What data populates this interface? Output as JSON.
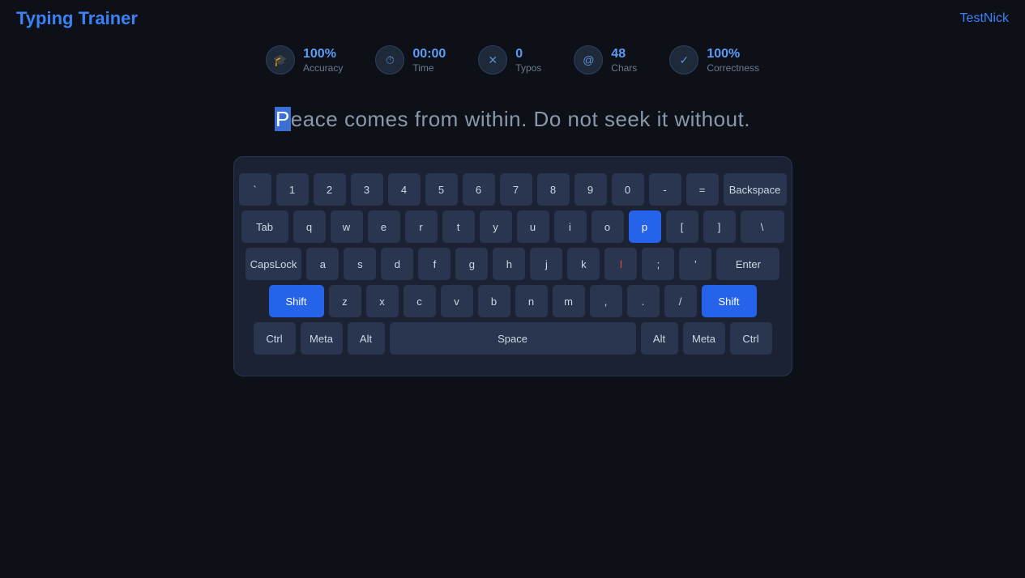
{
  "app": {
    "title": "Typing Trainer",
    "username": "TestNick"
  },
  "stats": [
    {
      "id": "accuracy",
      "icon": "graduation",
      "value": "100%",
      "label": "Accuracy"
    },
    {
      "id": "time",
      "icon": "clock",
      "value": "00:00",
      "label": "Time"
    },
    {
      "id": "typos",
      "icon": "x",
      "value": "0",
      "label": "Typos"
    },
    {
      "id": "chars",
      "icon": "at",
      "value": "48",
      "label": "Chars"
    },
    {
      "id": "correctness",
      "icon": "check",
      "value": "100%",
      "label": "Correctness"
    }
  ],
  "typing": {
    "text": "Peace comes from within. Do not seek it without.",
    "cursor_index": 0
  },
  "keyboard": {
    "rows": [
      {
        "keys": [
          {
            "label": "`",
            "type": "normal"
          },
          {
            "label": "1",
            "type": "normal"
          },
          {
            "label": "2",
            "type": "normal"
          },
          {
            "label": "3",
            "type": "normal"
          },
          {
            "label": "4",
            "type": "normal"
          },
          {
            "label": "5",
            "type": "normal"
          },
          {
            "label": "6",
            "type": "normal"
          },
          {
            "label": "7",
            "type": "normal"
          },
          {
            "label": "8",
            "type": "normal"
          },
          {
            "label": "9",
            "type": "normal"
          },
          {
            "label": "0",
            "type": "normal"
          },
          {
            "label": "-",
            "type": "normal"
          },
          {
            "label": "=",
            "type": "normal"
          },
          {
            "label": "Backspace",
            "type": "wide-backspace"
          }
        ]
      },
      {
        "keys": [
          {
            "label": "Tab",
            "type": "wide-tab"
          },
          {
            "label": "q",
            "type": "normal"
          },
          {
            "label": "w",
            "type": "normal"
          },
          {
            "label": "e",
            "type": "normal"
          },
          {
            "label": "r",
            "type": "normal"
          },
          {
            "label": "t",
            "type": "normal"
          },
          {
            "label": "y",
            "type": "normal"
          },
          {
            "label": "u",
            "type": "normal"
          },
          {
            "label": "i",
            "type": "normal"
          },
          {
            "label": "o",
            "type": "normal"
          },
          {
            "label": "p",
            "type": "active-blue"
          },
          {
            "label": "[",
            "type": "normal"
          },
          {
            "label": "]",
            "type": "normal"
          },
          {
            "label": "\\",
            "type": "backslash"
          }
        ]
      },
      {
        "keys": [
          {
            "label": "CapsLock",
            "type": "wide-caps"
          },
          {
            "label": "a",
            "type": "normal"
          },
          {
            "label": "s",
            "type": "normal"
          },
          {
            "label": "d",
            "type": "normal"
          },
          {
            "label": "f",
            "type": "normal"
          },
          {
            "label": "g",
            "type": "normal"
          },
          {
            "label": "h",
            "type": "normal"
          },
          {
            "label": "j",
            "type": "normal"
          },
          {
            "label": "k",
            "type": "normal"
          },
          {
            "label": "l",
            "type": "active-red"
          },
          {
            "label": ";",
            "type": "normal"
          },
          {
            "label": "'",
            "type": "normal"
          },
          {
            "label": "Enter",
            "type": "wide-enter"
          }
        ]
      },
      {
        "keys": [
          {
            "label": "Shift",
            "type": "shift-key"
          },
          {
            "label": "z",
            "type": "normal"
          },
          {
            "label": "x",
            "type": "normal"
          },
          {
            "label": "c",
            "type": "normal"
          },
          {
            "label": "v",
            "type": "normal"
          },
          {
            "label": "b",
            "type": "normal"
          },
          {
            "label": "n",
            "type": "normal"
          },
          {
            "label": "m",
            "type": "normal"
          },
          {
            "label": ",",
            "type": "normal"
          },
          {
            "label": ".",
            "type": "normal"
          },
          {
            "label": "/",
            "type": "normal"
          },
          {
            "label": "Shift",
            "type": "shift-key"
          }
        ]
      },
      {
        "keys": [
          {
            "label": "Ctrl",
            "type": "wide-ctrl"
          },
          {
            "label": "Meta",
            "type": "wide-meta"
          },
          {
            "label": "Alt",
            "type": "wide-alt"
          },
          {
            "label": "Space",
            "type": "wide-space"
          },
          {
            "label": "Alt",
            "type": "wide-alt"
          },
          {
            "label": "Meta",
            "type": "wide-meta"
          },
          {
            "label": "Ctrl",
            "type": "wide-ctrl"
          }
        ]
      }
    ]
  }
}
